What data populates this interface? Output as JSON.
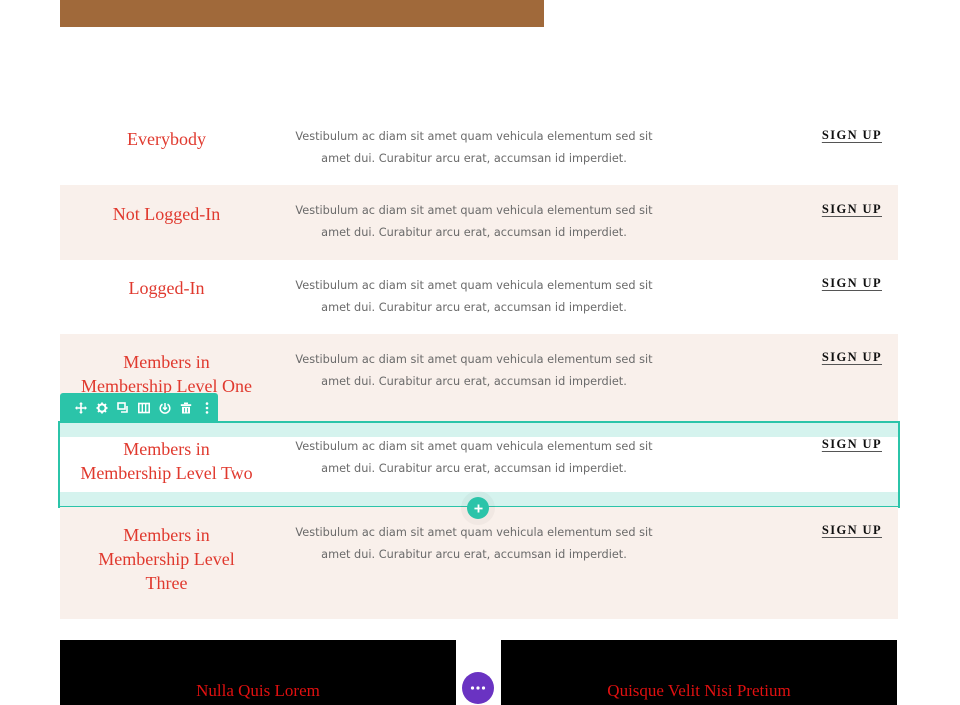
{
  "colors": {
    "brand_brown": "#a0693a",
    "title_red": "#e0392e",
    "row_beige": "#f9f0eb",
    "builder_teal": "#2bc4a9",
    "builder_teal_light": "#d5f3ee",
    "builder_purple": "#6a33c2"
  },
  "table": {
    "rows": [
      {
        "title": "Everybody",
        "desc_line1": "Vestibulum ac diam sit amet quam vehicula elementum sed sit",
        "desc_line2": "amet dui. Curabitur arcu erat, accumsan id imperdiet.",
        "action": "SIGN UP"
      },
      {
        "title": "Not Logged-In",
        "desc_line1": "Vestibulum ac diam sit amet quam vehicula elementum sed sit",
        "desc_line2": "amet dui. Curabitur arcu erat, accumsan id imperdiet.",
        "action": "SIGN UP"
      },
      {
        "title": "Logged-In",
        "desc_line1": "Vestibulum ac diam sit amet quam vehicula elementum sed sit",
        "desc_line2": "amet dui. Curabitur arcu erat, accumsan id imperdiet.",
        "action": "SIGN UP"
      },
      {
        "title_line1": "Members in",
        "title_line2": "Membership Level One",
        "desc_line1": "Vestibulum ac diam sit amet quam vehicula elementum sed sit",
        "desc_line2": "amet dui. Curabitur arcu erat, accumsan id imperdiet.",
        "action": "SIGN UP"
      },
      {
        "title_line1": "Members in",
        "title_line2": "Membership Level Two",
        "desc_line1": "Vestibulum ac diam sit amet quam vehicula elementum sed sit",
        "desc_line2": "amet dui. Curabitur arcu erat, accumsan id imperdiet.",
        "action": "SIGN UP"
      },
      {
        "title_line1": "Members in",
        "title_line2": "Membership Level",
        "title_line3": "Three",
        "desc_line1": "Vestibulum ac diam sit amet quam vehicula elementum sed sit",
        "desc_line2": "amet dui. Curabitur arcu erat, accumsan id imperdiet.",
        "action": "SIGN UP"
      }
    ]
  },
  "row_toolbar": {
    "icons": [
      "move-icon",
      "settings-icon",
      "duplicate-icon",
      "columns-icon",
      "save-icon",
      "delete-icon",
      "more-vertical-icon"
    ]
  },
  "builder": {
    "add_row_icon": "plus-icon",
    "more_icon": "more-horizontal-icon"
  },
  "bottom_blocks": [
    {
      "title": "Nulla Quis Lorem"
    },
    {
      "title": "Quisque Velit Nisi Pretium"
    }
  ]
}
